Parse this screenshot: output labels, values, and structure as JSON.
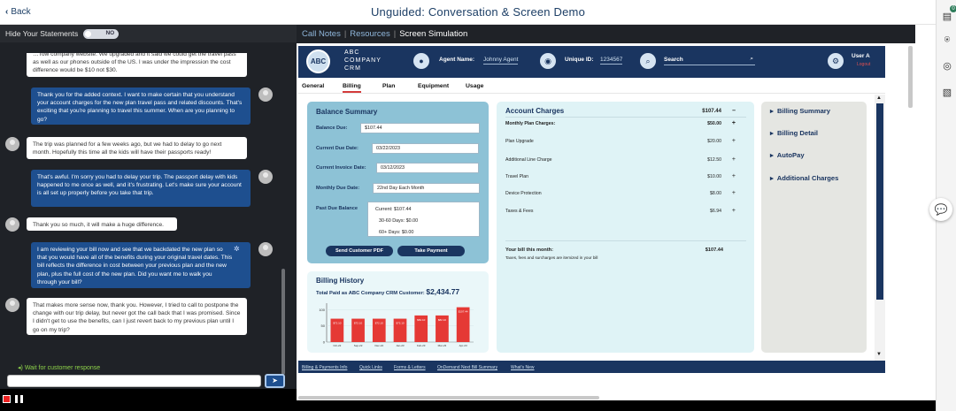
{
  "header": {
    "back_label": "Back",
    "title": "Unguided: Conversation & Screen Demo"
  },
  "left_panel": {
    "hide_statements_label": "Hide Your Statements",
    "toggle_value": "NO",
    "messages": [
      {
        "from": "customer",
        "text": "…Tow company website. We upgraded and it said we could get the travel pass as well as our phones outside of the US. I was under the impression the cost difference would be $10 not $30."
      },
      {
        "from": "agent",
        "text": "Thank you for the added context. I want to make certain that you understand your account charges for the new plan travel pass and related discounts. That's exciting that you're planning to travel this summer. When are you planning to go?"
      },
      {
        "from": "customer",
        "text": "The trip was planned for a few weeks ago, but we had to delay to go next month. Hopefully this time all the kids will have their passports ready!"
      },
      {
        "from": "agent",
        "text": "That's awful. I'm sorry you had to delay your trip. The passport delay with kids happened to me once as well, and it's frustrating. Let's make sure your account is all set up properly before you take that trip."
      },
      {
        "from": "customer",
        "text": "Thank you so much, it will make a huge difference."
      },
      {
        "from": "agent",
        "text": "I am reviewing your bill now and see that we backdated the new plan so that you would have all of the benefits during your original travel dates. This bill reflects the difference in cost between your previous plan and the new plan, plus the full cost of the new plan. Did you want me to walk you through your bill?"
      },
      {
        "from": "customer",
        "text": "That makes more sense now, thank you. However, I tried to call to postpone the change with our trip delay, but never got the call back that I was promised. Since I didn't get to use the benefits, can I just revert back to my previous plan until I go on my trip?"
      }
    ],
    "wait_label": "Wait for customer response"
  },
  "right_panel": {
    "tabs": [
      "Call Notes",
      "Resources",
      "Screen Simulation"
    ],
    "active_tab": "Screen Simulation"
  },
  "crm": {
    "logo_abbrev": "ABC",
    "logo_text": [
      "ABC",
      "COMPANY",
      "CRM"
    ],
    "agent_name_label": "Agent Name:",
    "agent_name_value": "Johnny Agent",
    "unique_id_label": "Unique ID:",
    "unique_id_value": "1234567",
    "search_label": "Search",
    "user_label": "User A",
    "logout_label": "Logout",
    "tabs": [
      "General",
      "Billing",
      "Plan",
      "Equipment",
      "Usage"
    ],
    "active_tab": "Billing",
    "balance_summary": {
      "title": "Balance Summary",
      "balance_due_label": "Balance Due:",
      "balance_due": "$107.44",
      "current_due_label": "Current Due Date:",
      "current_due": "03/22/2023",
      "invoice_date_label": "Current Invoice Date:",
      "invoice_date": "03/12/2023",
      "monthly_due_label": "Monthly Due Date:",
      "monthly_due": "22nd Day Each Month",
      "past_due_label": "Past Due Balance",
      "past_due_current_label": "Current:",
      "past_due_current": "$107.44",
      "past_due_30_label": "30-60 Days:",
      "past_due_30": "$0.00",
      "past_due_60_label": "60+ Days:",
      "past_due_60": "$0.00",
      "send_pdf_label": "Send Customer PDF",
      "take_payment_label": "Take Payment"
    },
    "billing_history": {
      "title": "Billing History",
      "total_label": "Total Paid as ABC Company CRM Customer:",
      "total_value": "$2,434.77"
    },
    "account_charges": {
      "title": "Account Charges",
      "total": "$107.44",
      "monthly_label": "Monthly Plan Charges:",
      "monthly_value": "$50.00",
      "rows": [
        {
          "label": "Plan Upgrade",
          "value": "$20.00"
        },
        {
          "label": "Additional Line Charge",
          "value": "$12.50"
        },
        {
          "label": "Travel Plan",
          "value": "$10.00"
        },
        {
          "label": "Device Protection",
          "value": "$8.00"
        },
        {
          "label": "Taxes & Fees",
          "value": "$6.94"
        }
      ],
      "bill_label": "Your bill this month:",
      "bill_value": "$107.44",
      "bill_note": "Taxes, fees and surcharges are itemized in your bill"
    },
    "side_menu": [
      "Billing Summary",
      "Billing Detail",
      "AutoPay",
      "Additional Charges"
    ],
    "footer_links": [
      "Billing & Payments Info",
      "Quick Links",
      "Forms & Letters",
      "OnDemand Next Bill Summary",
      "What's New"
    ]
  },
  "chart_data": {
    "type": "bar",
    "categories": [
      "Oct-22",
      "Sep-22",
      "Dec-22",
      "Jan-23",
      "Feb-23",
      "Mar-23",
      "Apr-23"
    ],
    "values": [
      72.1,
      72.1,
      72.1,
      72.1,
      82.1,
      82.1,
      107.44
    ],
    "data_labels": [
      "$72.10",
      "$72.10",
      "$72.10",
      "$72.10",
      "$82.10",
      "$82.10",
      "$107.44"
    ],
    "yticks": [
      0,
      50,
      100
    ],
    "ylim": [
      0,
      120
    ],
    "bar_color": "#e53935"
  }
}
